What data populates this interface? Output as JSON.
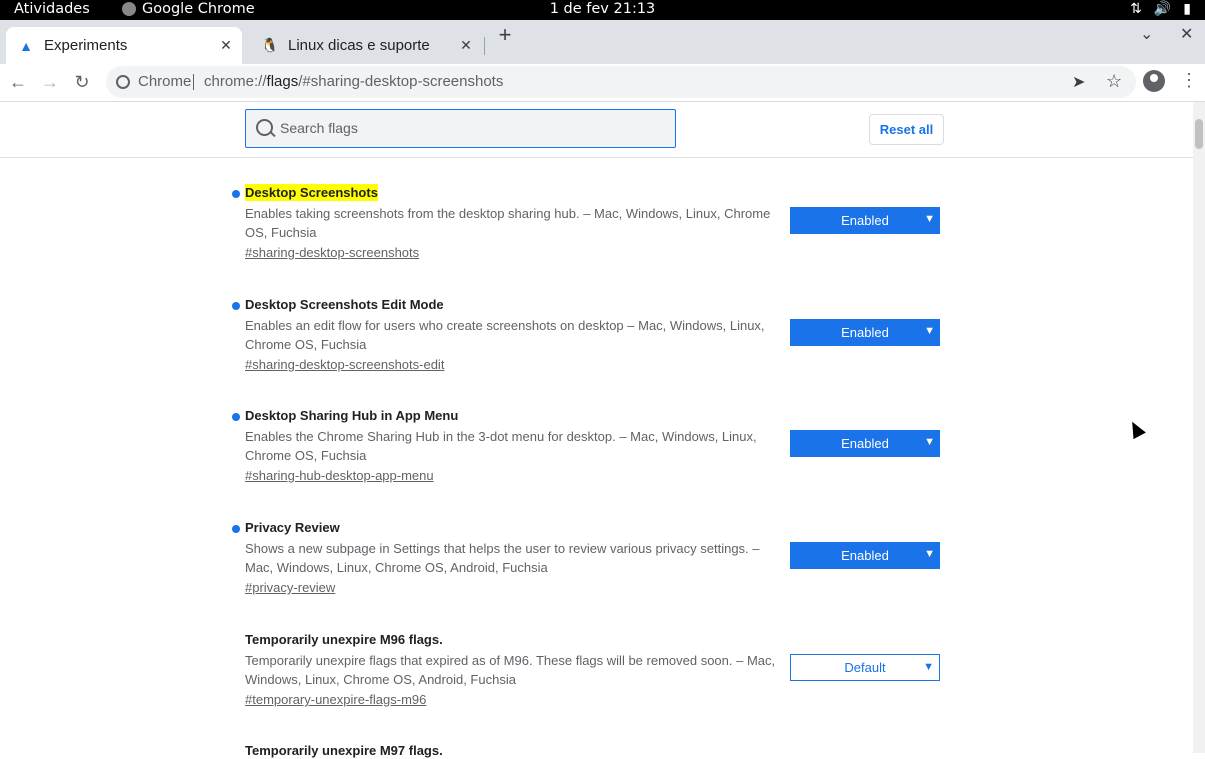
{
  "topbar": {
    "activities": "Atividades",
    "app_name": "Google Chrome",
    "clock": "1 de fev  21:13"
  },
  "tabs": [
    {
      "title": "Experiments",
      "icon": "flask-icon",
      "active": true
    },
    {
      "title": "Linux dicas e suporte",
      "icon": "tux-icon",
      "active": false
    }
  ],
  "toolbar": {
    "site_label": "Chrome",
    "url_prefix": "chrome://",
    "url_host": "flags",
    "url_rest": "/#sharing-desktop-screenshots"
  },
  "flags_page": {
    "search_placeholder": "Search flags",
    "reset_label": "Reset all"
  },
  "flags": [
    {
      "title": "Desktop Screenshots",
      "desc": "Enables taking screenshots from the desktop sharing hub. – Mac, Windows, Linux, Chrome OS, Fuchsia",
      "link": "#sharing-desktop-screenshots",
      "value": "Enabled"
    },
    {
      "title": "Desktop Screenshots Edit Mode",
      "desc": "Enables an edit flow for users who create screenshots on desktop – Mac, Windows, Linux, Chrome OS, Fuchsia",
      "link": "#sharing-desktop-screenshots-edit",
      "value": "Enabled"
    },
    {
      "title": "Desktop Sharing Hub in App Menu",
      "desc": "Enables the Chrome Sharing Hub in the 3-dot menu for desktop. – Mac, Windows, Linux, Chrome OS, Fuchsia",
      "link": "#sharing-hub-desktop-app-menu",
      "value": "Enabled"
    },
    {
      "title": "Privacy Review",
      "desc": "Shows a new subpage in Settings that helps the user to review various privacy settings. – Mac, Windows, Linux, Chrome OS, Android, Fuchsia",
      "link": "#privacy-review",
      "value": "Enabled"
    },
    {
      "title": "Temporarily unexpire M96 flags.",
      "desc": "Temporarily unexpire flags that expired as of M96. These flags will be removed soon. – Mac, Windows, Linux, Chrome OS, Android, Fuchsia",
      "link": "#temporary-unexpire-flags-m96",
      "value": "Default"
    },
    {
      "title": "Temporarily unexpire M97 flags.",
      "desc": "",
      "link": "",
      "value": ""
    }
  ],
  "colors": {
    "accent": "#1a73e8",
    "highlight": "#ffff00"
  }
}
